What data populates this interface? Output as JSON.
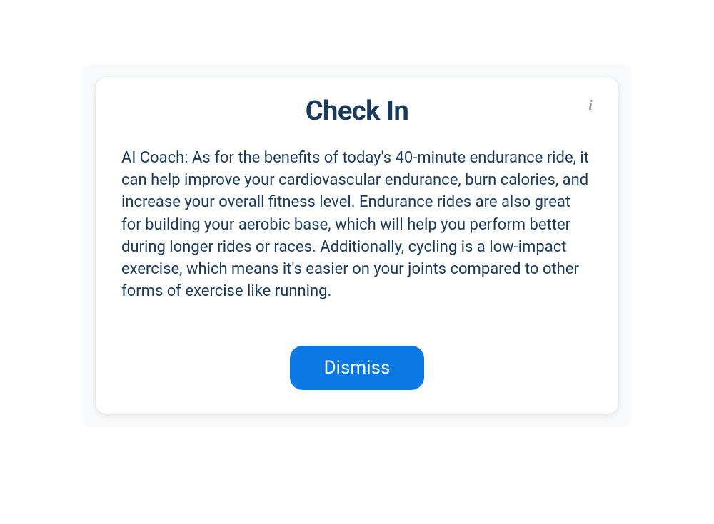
{
  "modal": {
    "title": "Check In",
    "body_text": "AI Coach: As for the benefits of today's 40-minute endurance ride, it can help improve your cardiovascular endurance, burn calories, and increase your overall fitness level. Endurance rides are also great for building your aerobic base, which will help you perform better during longer rides or races. Additionally, cycling is a low-impact exercise, which means it's easier on your joints compared to other forms of exercise like running.",
    "dismiss_label": "Dismiss",
    "info_glyph": "i"
  }
}
